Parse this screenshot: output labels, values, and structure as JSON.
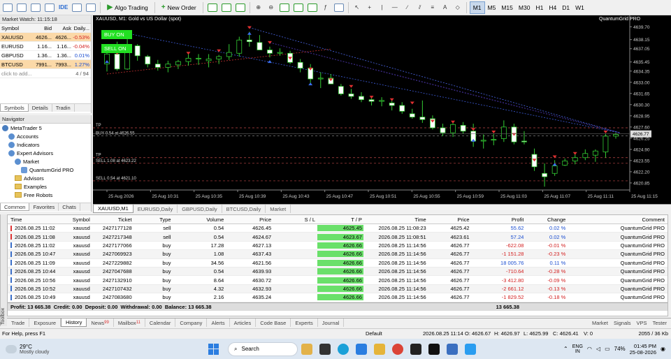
{
  "toolbar": {
    "ide": "IDE",
    "algo": "Algo Trading",
    "new_order": "New Order",
    "timeframes": [
      "M1",
      "M5",
      "M15",
      "M30",
      "H1",
      "H4",
      "D1",
      "W1"
    ],
    "active_tf": "M1"
  },
  "market_watch": {
    "title": "Market Watch: 11:15:18",
    "headers": [
      "Symbol",
      "Bid",
      "Ask",
      "Daily..."
    ],
    "rows": [
      {
        "symbol": "XAUUSD",
        "bid": "4626...",
        "ask": "4626...",
        "daily": "-0.53%",
        "neg": true,
        "hl": true
      },
      {
        "symbol": "EURUSD",
        "bid": "1.16...",
        "ask": "1.16...",
        "daily": "-0.04%",
        "neg": true,
        "hl": false
      },
      {
        "symbol": "GBPUSD",
        "bid": "1.36...",
        "ask": "1.36...",
        "daily": "0.01%",
        "neg": false,
        "hl": false
      },
      {
        "symbol": "BTCUSD",
        "bid": "7991...",
        "ask": "7993...",
        "daily": "1.27%",
        "neg": false,
        "hl": true
      }
    ],
    "add": "click to add...",
    "count": "4 / 94",
    "tabs": [
      "Symbols",
      "Details",
      "Tradin"
    ]
  },
  "navigator": {
    "title": "Navigator",
    "items": [
      {
        "label": "MetaTrader 5",
        "indent": 0,
        "kind": "app"
      },
      {
        "label": "Accounts",
        "indent": 1,
        "kind": "node"
      },
      {
        "label": "Indicators",
        "indent": 1,
        "kind": "node"
      },
      {
        "label": "Expert Advisors",
        "indent": 1,
        "kind": "node"
      },
      {
        "label": "Market",
        "indent": 2,
        "kind": "node"
      },
      {
        "label": "QuantumGrid PRO",
        "indent": 3,
        "kind": "ea"
      },
      {
        "label": "Advisors",
        "indent": 2,
        "kind": "folder"
      },
      {
        "label": "Examples",
        "indent": 2,
        "kind": "folder"
      },
      {
        "label": "Free Robots",
        "indent": 2,
        "kind": "folder"
      }
    ],
    "tabs": [
      "Common",
      "Favorites",
      "Chats"
    ]
  },
  "chart_data": {
    "type": "candlestick",
    "title": "XAUUSD, M1: Gold vs US Dollar (spot)",
    "ea_label": "QuantumGrid PRO",
    "buy_btn": "BUY ON",
    "sell_btn": "SELL ON",
    "yticks": [
      "4639.70",
      "4638.15",
      "4637.05",
      "4635.45",
      "4634.35",
      "4633.00",
      "4631.65",
      "4630.30",
      "4628.95",
      "4627.60",
      "4626.25",
      "4624.90",
      "4623.55",
      "4622.20",
      "4620.85"
    ],
    "ylim": [
      4620.0,
      4640.4
    ],
    "xticks": [
      "25 Aug 2026",
      "25 Aug 10:31",
      "25 Aug 10:35",
      "25 Aug 10:39",
      "25 Aug 10:43",
      "25 Aug 10:47",
      "25 Aug 10:51",
      "25 Aug 10:55",
      "25 Aug 10:59",
      "25 Aug 11:03",
      "25 Aug 11:07",
      "25 Aug 11:11",
      "25 Aug 11:15"
    ],
    "price_marker": "4626.77",
    "lines": [
      {
        "label": "TP",
        "price": 4627.5
      },
      {
        "label": "BUY 0.54 at 4626.55",
        "price": 4626.55
      },
      {
        "label": "TP",
        "price": 4623.9
      },
      {
        "label": "SELL 1.08 at 4623.22",
        "price": 4623.22
      },
      {
        "label": "SELL 0.54 at 4621.10",
        "price": 4621.1
      }
    ],
    "candles": [
      [
        4635.2,
        4636.6,
        4634.3,
        4636.4
      ],
      [
        4636.4,
        4637.9,
        4634.4,
        4634.6
      ],
      [
        4634.6,
        4638.2,
        4634.5,
        4637.4
      ],
      [
        4637.4,
        4637.6,
        4635.6,
        4636.2
      ],
      [
        4636.1,
        4636.3,
        4634.8,
        4635.2
      ],
      [
        4635.2,
        4635.7,
        4634.4,
        4634.8
      ],
      [
        4634.8,
        4635.6,
        4634.2,
        4635.2
      ],
      [
        4635.1,
        4635.7,
        4634.6,
        4635.5
      ],
      [
        4635.5,
        4636.4,
        4635.0,
        4635.9
      ],
      [
        4635.9,
        4636.4,
        4635.1,
        4635.9
      ],
      [
        4635.6,
        4636.4,
        4634.8,
        4635.8
      ],
      [
        4635.8,
        4636.3,
        4635.2,
        4636.1
      ],
      [
        4636.1,
        4637.6,
        4635.7,
        4636.6
      ],
      [
        4636.5,
        4638.5,
        4636.1,
        4638.1
      ],
      [
        4638.1,
        4639.1,
        4637.3,
        4637.9
      ],
      [
        4637.8,
        4638.7,
        4636.9,
        4636.9
      ],
      [
        4636.9,
        4637.3,
        4636.0,
        4636.5
      ],
      [
        4636.5,
        4637.1,
        4636.2,
        4636.6
      ],
      [
        4636.5,
        4636.8,
        4635.2,
        4635.4
      ],
      [
        4635.4,
        4635.8,
        4634.2,
        4634.7
      ],
      [
        4634.7,
        4635.2,
        4632.9,
        4633.4
      ],
      [
        4633.4,
        4634.2,
        4632.3,
        4633.5
      ],
      [
        4633.5,
        4634.0,
        4632.8,
        4632.8
      ],
      [
        4632.5,
        4632.8,
        4631.4,
        4631.6
      ],
      [
        4631.6,
        4632.2,
        4631.0,
        4631.3
      ],
      [
        4631.3,
        4631.8,
        4630.6,
        4630.9
      ],
      [
        4630.9,
        4631.3,
        4630.2,
        4630.7
      ],
      [
        4630.7,
        4631.2,
        4630.1,
        4630.8
      ],
      [
        4630.5,
        4631.0,
        4629.6,
        4630.2
      ],
      [
        4630.2,
        4630.6,
        4629.2,
        4629.5
      ],
      [
        4629.2,
        4629.8,
        4628.6,
        4628.8
      ],
      [
        4628.8,
        4630.8,
        4628.1,
        4628.5
      ],
      [
        4628.6,
        4629.0,
        4627.3,
        4627.5
      ],
      [
        4627.5,
        4628.0,
        4626.5,
        4626.9
      ],
      [
        4626.9,
        4628.3,
        4626.4,
        4627.9
      ],
      [
        4627.8,
        4628.2,
        4626.8,
        4627.1
      ],
      [
        4627.1,
        4628.0,
        4625.2,
        4625.9
      ],
      [
        4625.9,
        4626.7,
        4625.0,
        4626.0
      ],
      [
        4626.1,
        4626.8,
        4625.4,
        4626.1
      ],
      [
        4626.2,
        4628.4,
        4625.8,
        4627.6
      ],
      [
        4627.6,
        4628.0,
        4625.5,
        4625.8
      ],
      [
        4625.9,
        4627.1,
        4625.5,
        4625.8
      ],
      [
        4624.3,
        4625.0,
        4622.3,
        4622.8
      ],
      [
        4622.0,
        4623.2,
        4620.4,
        4621.6
      ],
      [
        4622.0,
        4623.6,
        4621.7,
        4622.9
      ],
      [
        4623.0,
        4623.8,
        4622.9,
        4623.5
      ],
      [
        4623.5,
        4624.3,
        4623.1,
        4623.9
      ],
      [
        4623.9,
        4624.9,
        4623.6,
        4624.4
      ],
      [
        4624.2,
        4624.9,
        4623.4,
        4624.7
      ],
      [
        4624.6,
        4626.8,
        4623.9,
        4626.5
      ],
      [
        4626.5,
        4626.9,
        4626.2,
        4626.7
      ]
    ],
    "arrows": [
      [
        0,
        4637.3,
        "s"
      ],
      [
        1,
        4636.5,
        "s"
      ],
      [
        2,
        4638.9,
        "s"
      ],
      [
        8,
        4636.5,
        "s"
      ],
      [
        11,
        4636.8,
        "s"
      ],
      [
        14,
        4639.6,
        "s"
      ],
      [
        16,
        4637.8,
        "s"
      ],
      [
        18,
        4635.9,
        "s"
      ],
      [
        20,
        4634.6,
        "s"
      ],
      [
        22,
        4633.3,
        "s"
      ],
      [
        24,
        4632.5,
        "s"
      ],
      [
        26,
        4631.2,
        "s"
      ],
      [
        28,
        4630.9,
        "s"
      ],
      [
        30,
        4630.5,
        "s"
      ],
      [
        32,
        4628.3,
        "s"
      ],
      [
        34,
        4628.2,
        "s"
      ],
      [
        36,
        4627.3,
        "s"
      ],
      [
        38,
        4627.0,
        "s"
      ],
      [
        40,
        4626.7,
        "s"
      ],
      [
        42,
        4623.6,
        "s"
      ],
      [
        44,
        4624.0,
        "s"
      ],
      [
        46,
        4624.4,
        "s"
      ],
      [
        49,
        4627.0,
        "s"
      ],
      [
        0,
        4635.5,
        "b"
      ],
      [
        2,
        4636.8,
        "b"
      ],
      [
        14,
        4638.9,
        "b"
      ],
      [
        16,
        4635.5,
        "b"
      ],
      [
        20,
        4632.8,
        "b"
      ],
      [
        36,
        4626.0,
        "b"
      ],
      [
        44,
        4623.1,
        "b"
      ]
    ]
  },
  "chart_tabs": [
    "XAUUSD,M1",
    "EURUSD,Daily",
    "GBPUSD,Daily",
    "BTCUSD,Daily",
    "Market"
  ],
  "terminal": {
    "headers": [
      "Time",
      "Symbol",
      "Ticket",
      "Type",
      "Volume",
      "Price",
      "S / L",
      "T / P",
      "Time",
      "Price",
      "Profit",
      "Change",
      "Comment"
    ],
    "rows": [
      [
        "2026.08.25 11:02:30",
        "xauusd",
        "2427177128",
        "sell",
        "0.54",
        "4626.45",
        "",
        "4625.45",
        "2026.08.25 11:08:23",
        "4625.42",
        "55.62",
        "0.02 %",
        "QuantumGrid PRO"
      ],
      [
        "2026.08.25 11:08:30",
        "xauusd",
        "2427217348",
        "sell",
        "0.54",
        "4624.67",
        "",
        "4623.67",
        "2026.08.25 11:08:51",
        "4623.61",
        "57.24",
        "0.02 %",
        "QuantumGrid PRO"
      ],
      [
        "2026.08.25 11:02:30",
        "xauusd",
        "2427177066",
        "buy",
        "17.28",
        "4627.13",
        "",
        "4626.66",
        "2026.08.25 11:14:56",
        "4626.77",
        "-622.08",
        "-0.01 %",
        "QuantumGrid PRO"
      ],
      [
        "2026.08.25 10:47:59",
        "xauusd",
        "2427069923",
        "buy",
        "1.08",
        "4637.43",
        "",
        "4626.66",
        "2026.08.25 11:14:56",
        "4626.77",
        "-1 151.28",
        "-0.23 %",
        "QuantumGrid PRO"
      ],
      [
        "2026.08.25 11:09:00",
        "xauusd",
        "2427229882",
        "buy",
        "34.56",
        "4621.56",
        "",
        "4626.66",
        "2026.08.25 11:14:56",
        "4626.77",
        "18 005.76",
        "0.11 %",
        "QuantumGrid PRO"
      ],
      [
        "2026.08.25 10:44:28",
        "xauusd",
        "2427047688",
        "buy",
        "0.54",
        "4639.93",
        "",
        "4626.66",
        "2026.08.25 11:14:56",
        "4626.77",
        "-710.64",
        "-0.28 %",
        "QuantumGrid PRO"
      ],
      [
        "2026.08.25 10:56:00",
        "xauusd",
        "2427132910",
        "buy",
        "8.64",
        "4630.72",
        "",
        "4626.66",
        "2026.08.25 11:14:56",
        "4626.77",
        "-3 412.80",
        "-0.09 %",
        "QuantumGrid PRO"
      ],
      [
        "2026.08.25 10:52:30",
        "xauusd",
        "2427107432",
        "buy",
        "4.32",
        "4632.93",
        "",
        "4626.66",
        "2026.08.25 11:14:56",
        "4626.77",
        "-2 661.12",
        "-0.13 %",
        "QuantumGrid PRO"
      ],
      [
        "2026.08.25 10:49:29",
        "xauusd",
        "2427083680",
        "buy",
        "2.16",
        "4635.24",
        "",
        "4626.66",
        "2026.08.25 11:14:56",
        "4626.77",
        "-1 829.52",
        "-0.18 %",
        "QuantumGrid PRO"
      ]
    ],
    "summary": "Profit: 13 665.38  Credit: 0.00  Deposit: 0.00  Withdrawal: 0.00  Balance: 13 665.38",
    "summary_total": "13 665.38",
    "toolbox": "Toolbox"
  },
  "bottom_tabs": [
    {
      "label": "Trade"
    },
    {
      "label": "Exposure"
    },
    {
      "label": "History",
      "active": true
    },
    {
      "label": "News",
      "badge": "99"
    },
    {
      "label": "Mailbox",
      "badge": "11"
    },
    {
      "label": "Calendar"
    },
    {
      "label": "Company"
    },
    {
      "label": "Alerts"
    },
    {
      "label": "Articles"
    },
    {
      "label": "Code Base"
    },
    {
      "label": "Experts"
    },
    {
      "label": "Journal"
    }
  ],
  "bottom_right": [
    "Market",
    "Signals",
    "VPS",
    "Tester"
  ],
  "status": {
    "help": "For Help, press F1",
    "profile": "Default",
    "datetime": "2026.08.25 11:14",
    "open": "O: 4626.67",
    "high": "H: 4626.97",
    "low": "L: 4625.99",
    "close": "C: 4626.41",
    "vol": "V: 0",
    "traffic": "2055 / 36 Kb"
  },
  "taskbar": {
    "temp": "29°C",
    "weather": "Mostly cloudy",
    "search": "Search",
    "lang1": "ENG",
    "lang2": "IN",
    "battery": "74%",
    "time": "01:45 PM",
    "date": "25-08-2026"
  }
}
